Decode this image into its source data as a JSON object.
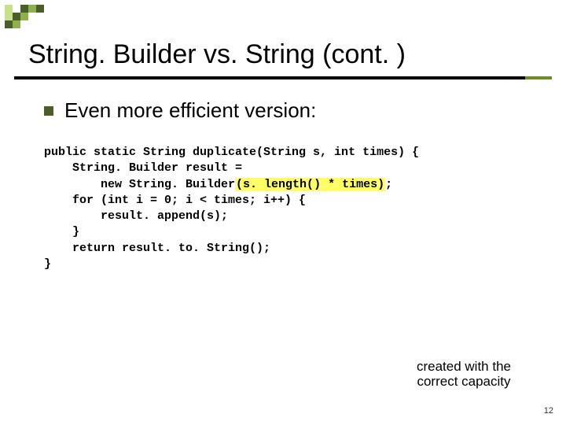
{
  "logo": {
    "colors": {
      "dark": "#4b5e2a",
      "mid": "#8fb04a",
      "light": "#c9e08a",
      "blank": "transparent"
    },
    "pattern": [
      [
        "light",
        "blank",
        "dark",
        "mid",
        "dark"
      ],
      [
        "light",
        "dark",
        "mid",
        "blank",
        "blank"
      ],
      [
        "dark",
        "mid",
        "blank",
        "blank",
        "blank"
      ]
    ]
  },
  "title": "String. Builder vs. String (cont. )",
  "bullet": {
    "text": "Even more efficient version:"
  },
  "code": {
    "line1_a": "public static String duplicate(String s, int times) {",
    "line2": "    String. Builder result =",
    "line3_a": "        new String. Builder",
    "line3_hl": "(s. length() * times)",
    "line3_b": ";",
    "line4": "    for (int i = 0; i < times; i++) {",
    "line5": "        result. append(s);",
    "line6": "    }",
    "line7": "    return result. to. String();",
    "line8": "}"
  },
  "callout": {
    "text": "created with the correct capacity"
  },
  "page_number": "12",
  "colors": {
    "accent": "#6b8e23",
    "highlight": "#ffff66"
  }
}
